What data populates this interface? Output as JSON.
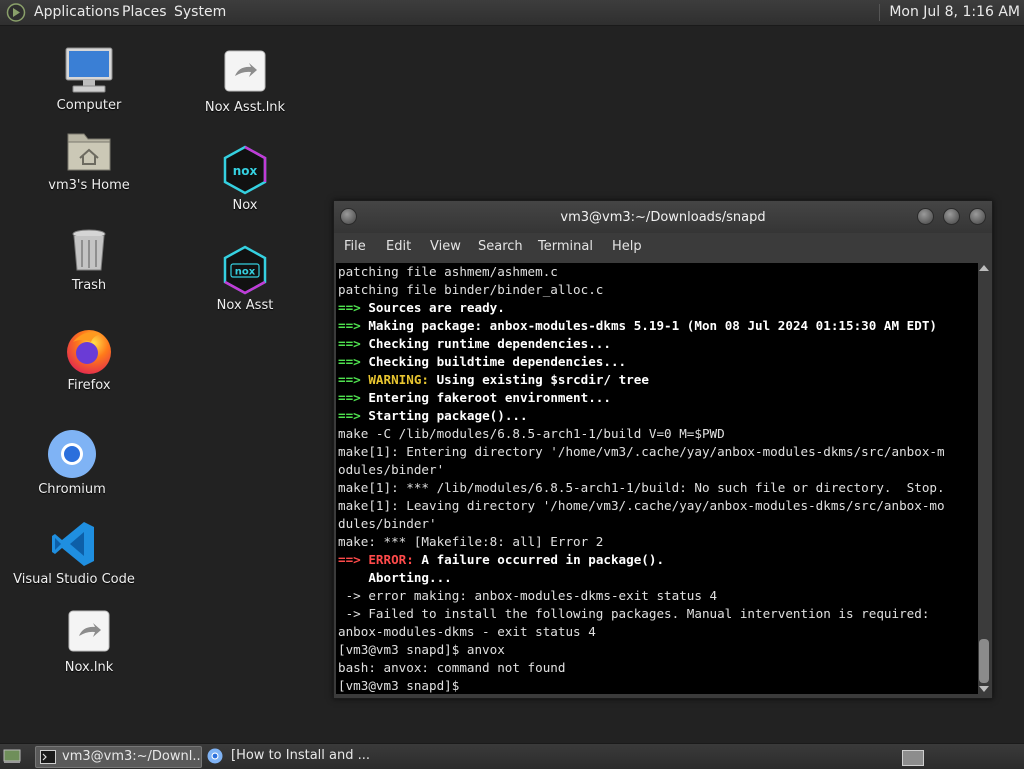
{
  "top_panel": {
    "menus": [
      "Applications",
      "Places",
      "System"
    ],
    "clock": "Mon Jul  8,  1:16 AM"
  },
  "desktop_icons": [
    {
      "label": "Computer",
      "icon": "computer-icon"
    },
    {
      "label": "vm3's Home",
      "icon": "home-folder-icon"
    },
    {
      "label": "Trash",
      "icon": "trash-icon"
    },
    {
      "label": "Firefox",
      "icon": "firefox-icon"
    },
    {
      "label": "Chromium",
      "icon": "chromium-icon"
    },
    {
      "label": "Visual Studio Code",
      "icon": "vscode-icon"
    },
    {
      "label": "Nox.lnk",
      "icon": "shortcut-icon"
    },
    {
      "label": "Nox Asst.lnk",
      "icon": "shortcut-icon"
    },
    {
      "label": "Nox",
      "icon": "nox-icon"
    },
    {
      "label": "Nox Asst",
      "icon": "nox-asst-icon"
    }
  ],
  "terminal": {
    "title": "vm3@vm3:~/Downloads/snapd",
    "menu": [
      "File",
      "Edit",
      "View",
      "Search",
      "Terminal",
      "Help"
    ],
    "lines": [
      "patching file ashmem/ashmem.c",
      "patching file binder/binder_alloc.c",
      "==> Sources are ready.",
      "==> Making package: anbox-modules-dkms 5.19-1 (Mon 08 Jul 2024 01:15:30 AM EDT)",
      "==> Checking runtime dependencies...",
      "==> Checking buildtime dependencies...",
      "==> WARNING: Using existing $srcdir/ tree",
      "==> Entering fakeroot environment...",
      "==> Starting package()...",
      "make -C /lib/modules/6.8.5-arch1-1/build V=0 M=$PWD",
      "make[1]: Entering directory '/home/vm3/.cache/yay/anbox-modules-dkms/src/anbox-m",
      "odules/binder'",
      "make[1]: *** /lib/modules/6.8.5-arch1-1/build: No such file or directory.  Stop.",
      "make[1]: Leaving directory '/home/vm3/.cache/yay/anbox-modules-dkms/src/anbox-mo",
      "dules/binder'",
      "make: *** [Makefile:8: all] Error 2",
      "==> ERROR: A failure occurred in package().",
      "    Aborting...",
      " -> error making: anbox-modules-dkms-exit status 4",
      " -> Failed to install the following packages. Manual intervention is required:",
      "anbox-modules-dkms - exit status 4",
      "[vm3@vm3 snapd]$ anvox",
      "bash: anvox: command not found",
      "[vm3@vm3 snapd]$ "
    ]
  },
  "taskbar": {
    "tasks": [
      {
        "label": "vm3@vm3:~/Downl...",
        "icon": "terminal-icon"
      },
      {
        "label": "[How to Install and ...",
        "icon": "chromium-icon"
      }
    ]
  }
}
